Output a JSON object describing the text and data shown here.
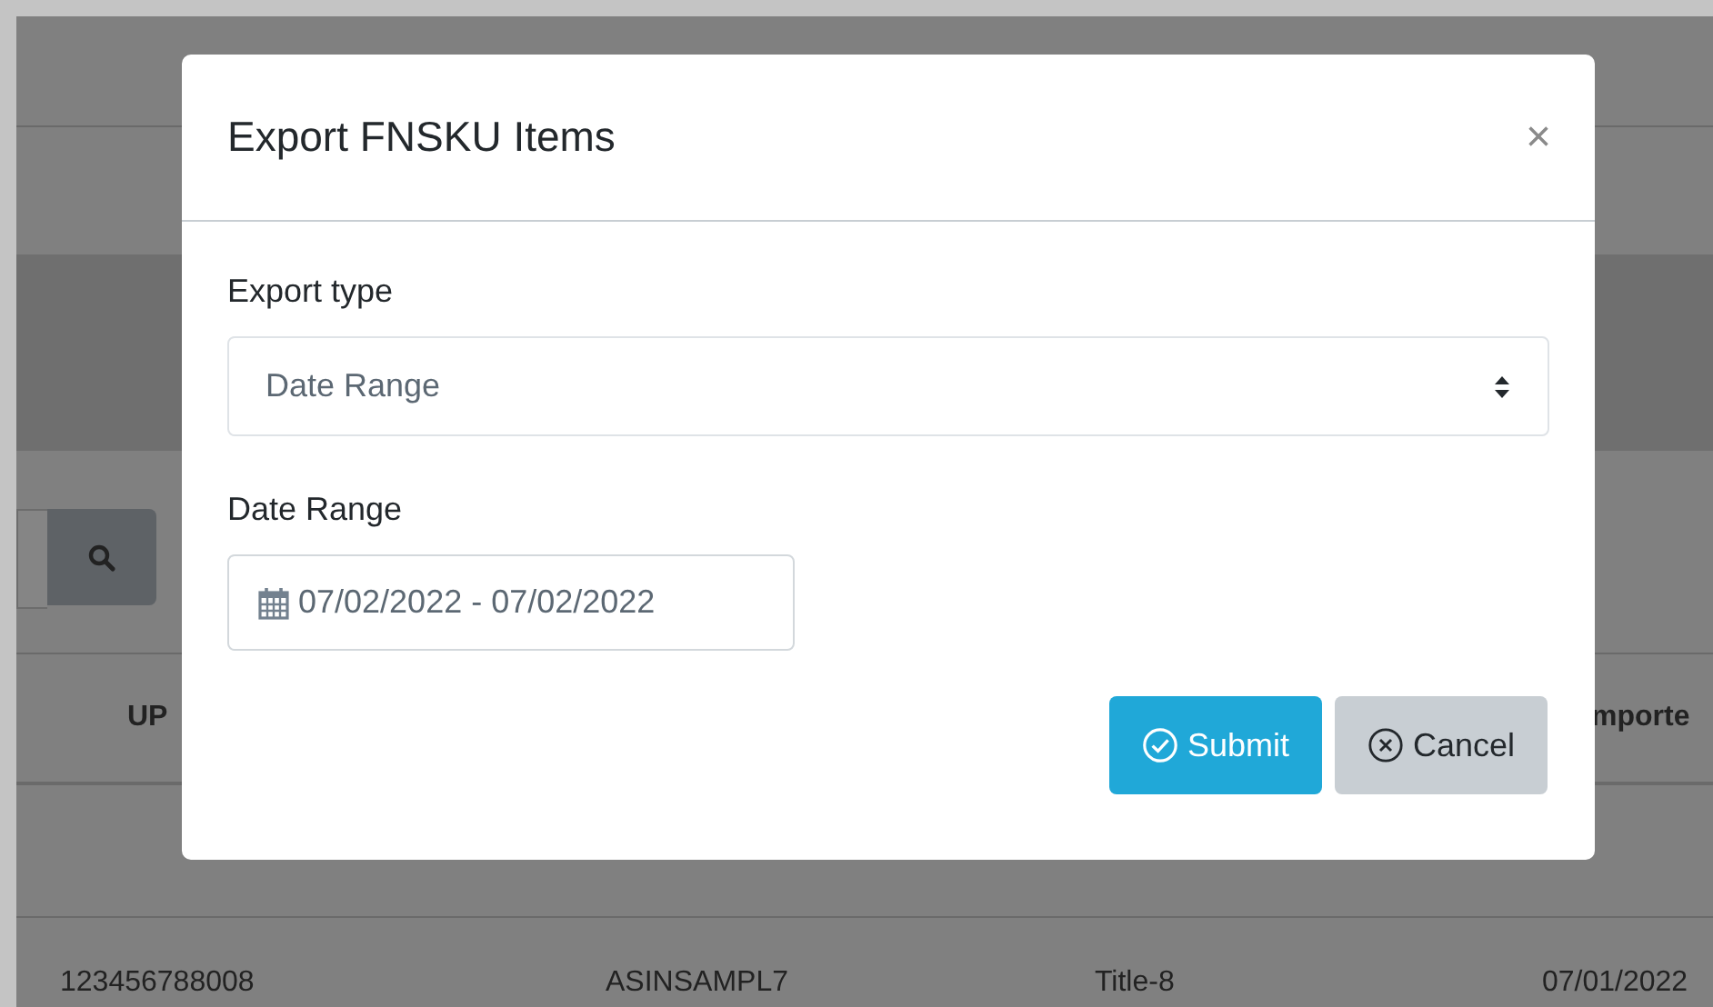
{
  "background": {
    "table": {
      "columns": [
        "UP",
        "",
        "",
        "mporte"
      ],
      "rows": [
        [
          "123456788008",
          "ASINSAMPL7",
          "Title-8",
          "07/01/2022"
        ]
      ]
    }
  },
  "modal": {
    "title": "Export FNSKU Items",
    "close": "×",
    "fields": [
      {
        "kind": "select",
        "label": "Export type",
        "value": "Date Range"
      },
      {
        "kind": "daterange",
        "label": "Date Range",
        "value": "07/02/2022 - 07/02/2022"
      }
    ],
    "buttons": [
      {
        "kind": "submit",
        "label": "Submit"
      },
      {
        "kind": "cancel",
        "label": "Cancel"
      }
    ]
  }
}
